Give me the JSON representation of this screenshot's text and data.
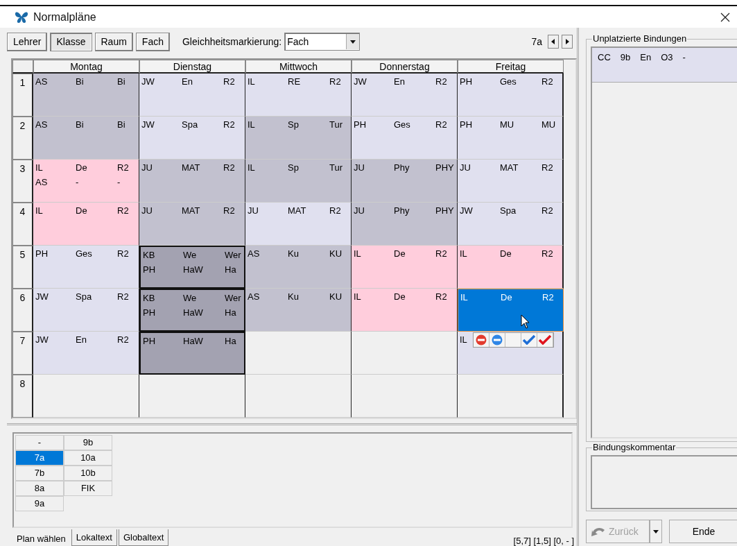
{
  "window": {
    "title": "Normalpläne"
  },
  "toolbar": {
    "view_buttons": [
      {
        "label": "Lehrer",
        "selected": false
      },
      {
        "label": "Klasse",
        "selected": true
      },
      {
        "label": "Raum",
        "selected": false
      },
      {
        "label": "Fach",
        "selected": false
      }
    ],
    "marking_label": "Gleichheitsmarkierung:",
    "marking_value": "Fach",
    "current_plan": "7a"
  },
  "timetable": {
    "days": [
      "Montag",
      "Dienstag",
      "Mittwoch",
      "Donnerstag",
      "Freitag"
    ],
    "periods": [
      {
        "number": "1",
        "cells": [
          {
            "kind": "gray",
            "lines": [
              [
                "AS",
                "Bi",
                "Bi"
              ]
            ]
          },
          {
            "kind": "light",
            "lines": [
              [
                "JW",
                "En",
                "R2"
              ]
            ]
          },
          {
            "kind": "light",
            "lines": [
              [
                "IL",
                "RE",
                "R2"
              ]
            ]
          },
          {
            "kind": "light",
            "lines": [
              [
                "JW",
                "En",
                "R2"
              ]
            ]
          },
          {
            "kind": "light",
            "lines": [
              [
                "PH",
                "Ges",
                "R2"
              ]
            ]
          }
        ]
      },
      {
        "number": "2",
        "cells": [
          {
            "kind": "gray",
            "lines": [
              [
                "AS",
                "Bi",
                "Bi"
              ]
            ]
          },
          {
            "kind": "light",
            "lines": [
              [
                "JW",
                "Spa",
                "R2"
              ]
            ]
          },
          {
            "kind": "gray",
            "lines": [
              [
                "IL",
                "Sp",
                "Tur"
              ]
            ]
          },
          {
            "kind": "light",
            "lines": [
              [
                "PH",
                "Ges",
                "R2"
              ]
            ]
          },
          {
            "kind": "light",
            "lines": [
              [
                "PH",
                "MU",
                "MU"
              ]
            ]
          }
        ]
      },
      {
        "number": "3",
        "cells": [
          {
            "kind": "pink",
            "lines": [
              [
                "IL",
                "De",
                "R2"
              ],
              [
                "AS",
                "-",
                "-"
              ]
            ]
          },
          {
            "kind": "gray",
            "lines": [
              [
                "JU",
                "MAT",
                "R2"
              ]
            ]
          },
          {
            "kind": "gray",
            "lines": [
              [
                "IL",
                "Sp",
                "Tur"
              ]
            ]
          },
          {
            "kind": "gray",
            "lines": [
              [
                "JU",
                "Phy",
                "PHY"
              ]
            ]
          },
          {
            "kind": "light",
            "lines": [
              [
                "JU",
                "MAT",
                "R2"
              ]
            ]
          }
        ]
      },
      {
        "number": "4",
        "cells": [
          {
            "kind": "pink",
            "lines": [
              [
                "IL",
                "De",
                "R2"
              ]
            ]
          },
          {
            "kind": "gray",
            "lines": [
              [
                "JU",
                "MAT",
                "R2"
              ]
            ]
          },
          {
            "kind": "light",
            "lines": [
              [
                "JU",
                "MAT",
                "R2"
              ]
            ]
          },
          {
            "kind": "gray",
            "lines": [
              [
                "JU",
                "Phy",
                "PHY"
              ]
            ]
          },
          {
            "kind": "light",
            "lines": [
              [
                "JW",
                "Spa",
                "R2"
              ]
            ]
          }
        ]
      },
      {
        "number": "5",
        "cells": [
          {
            "kind": "light",
            "lines": [
              [
                "PH",
                "Ges",
                "R2"
              ]
            ]
          },
          {
            "kind": "coupled",
            "lines": [
              [
                "KB",
                "We",
                "Wer"
              ],
              [
                "PH",
                "HaW",
                "Ha"
              ]
            ]
          },
          {
            "kind": "gray",
            "lines": [
              [
                "AS",
                "Ku",
                "KU"
              ]
            ]
          },
          {
            "kind": "pink",
            "lines": [
              [
                "IL",
                "De",
                "R2"
              ]
            ]
          },
          {
            "kind": "pink",
            "lines": [
              [
                "IL",
                "De",
                "R2"
              ]
            ]
          }
        ]
      },
      {
        "number": "6",
        "cells": [
          {
            "kind": "light",
            "lines": [
              [
                "JW",
                "Spa",
                "R2"
              ]
            ]
          },
          {
            "kind": "coupled",
            "lines": [
              [
                "KB",
                "We",
                "Wer"
              ],
              [
                "PH",
                "HaW",
                "Ha"
              ]
            ]
          },
          {
            "kind": "gray",
            "lines": [
              [
                "AS",
                "Ku",
                "KU"
              ]
            ]
          },
          {
            "kind": "pink",
            "lines": [
              [
                "IL",
                "De",
                "R2"
              ]
            ]
          },
          {
            "kind": "selected",
            "lines": [
              [
                "IL",
                "De",
                "R2"
              ]
            ]
          }
        ]
      },
      {
        "number": "7",
        "cells": [
          {
            "kind": "light",
            "lines": [
              [
                "JW",
                "En",
                "R2"
              ]
            ]
          },
          {
            "kind": "coupled",
            "lines": [
              [
                "PH",
                "HaW",
                "Ha"
              ]
            ]
          },
          {
            "kind": "empty"
          },
          {
            "kind": "empty"
          },
          {
            "kind": "light",
            "lines": [
              [
                "IL"
              ]
            ],
            "popup": true
          }
        ]
      },
      {
        "number": "8",
        "cells": [
          {
            "kind": "empty"
          },
          {
            "kind": "empty"
          },
          {
            "kind": "empty"
          },
          {
            "kind": "empty"
          },
          {
            "kind": "empty"
          }
        ]
      }
    ]
  },
  "plan_list": [
    {
      "label": "-",
      "selected": false
    },
    {
      "label": "7a",
      "selected": true
    },
    {
      "label": "7b",
      "selected": false
    },
    {
      "label": "8a",
      "selected": false
    },
    {
      "label": "9a",
      "selected": false
    },
    {
      "label": "9b",
      "selected": false
    },
    {
      "label": "10a",
      "selected": false
    },
    {
      "label": "10b",
      "selected": false
    },
    {
      "label": "FIK",
      "selected": false
    }
  ],
  "bottom_tabs": [
    {
      "label": "Plan wählen",
      "selected": true
    },
    {
      "label": "Lokaltext",
      "selected": false
    },
    {
      "label": "Globaltext",
      "selected": false
    }
  ],
  "status": "[5,7] [1,5] [0, - ]",
  "unplaced": {
    "title": "Unplatzierte Bindungen",
    "items": [
      [
        "CC",
        "9b",
        "En",
        "O3",
        "-"
      ]
    ]
  },
  "comment": {
    "title": "Bindungskommentar"
  },
  "back_button": {
    "label": "Zurück",
    "disabled": true
  },
  "end_button": {
    "label": "Ende"
  }
}
